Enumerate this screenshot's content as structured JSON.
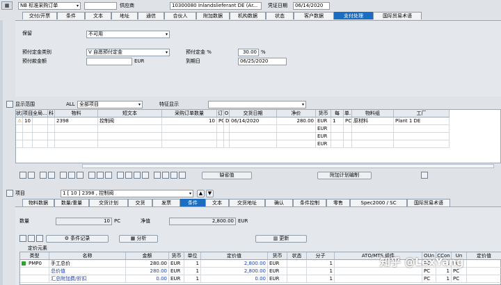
{
  "header": {
    "order_type": "NB 标准采购订单",
    "vendor_label": "供应商",
    "vendor_value": "10300080 Inlandslieferant DE (Ar...",
    "doc_date_label": "凭证日期",
    "doc_date_value": "06/14/2020"
  },
  "header_tabs": [
    "交付/开票",
    "条件",
    "文本",
    "地址",
    "通信",
    "合伙人",
    "附加数据",
    "机构数据",
    "状态",
    "客户数据",
    "支付处理",
    "国际贸易术语"
  ],
  "header_tabs_active": 10,
  "payment": {
    "retention_label": "保留",
    "retention_value": "不可用",
    "dp_category_label": "预付定金类别",
    "dp_category_value": "V  自愿预付定金",
    "dp_pct_label": "预付定金 %",
    "dp_pct_value": "30.00",
    "dp_pct_unit": "%",
    "dp_amount_label": "预付款金额",
    "dp_amount_value": "",
    "dp_amount_currency": "EUR",
    "due_date_label": "到期日",
    "due_date_value": "06/25/2020"
  },
  "items_overview": {
    "display_label": "显示范围",
    "display_code": "ALL",
    "display_value": "全部项目",
    "feature_label": "特征显示",
    "columns": [
      "状态",
      "项目",
      "全局...",
      "科",
      "物料",
      "短文本",
      "采购订单数量",
      "订",
      "O",
      "交货日期",
      "净价",
      "货币",
      "每",
      "单.",
      "物料组",
      "工厂"
    ],
    "rows": [
      {
        "item": "10",
        "material": "2398",
        "short_text": "控制阀",
        "qty": "10",
        "unit": "PC",
        "o": "D",
        "date": "06/14/2020",
        "price": "280.00",
        "currency": "EUR",
        "per": "1",
        "unit2": "PC",
        "mat_group": "原材料",
        "plant": "Plant 1 DE"
      },
      {
        "item": "",
        "material": "",
        "short_text": "",
        "qty": "",
        "unit": "",
        "o": "",
        "date": "",
        "price": "",
        "currency": "EUR",
        "per": "",
        "unit2": "",
        "mat_group": "",
        "plant": ""
      },
      {
        "item": "",
        "material": "",
        "short_text": "",
        "qty": "",
        "unit": "",
        "o": "",
        "date": "",
        "price": "",
        "currency": "EUR",
        "per": "",
        "unit2": "",
        "mat_group": "",
        "plant": ""
      },
      {
        "item": "",
        "material": "",
        "short_text": "",
        "qty": "",
        "unit": "",
        "o": "",
        "date": "",
        "price": "",
        "currency": "EUR",
        "per": "",
        "unit2": "",
        "mat_group": "",
        "plant": ""
      }
    ],
    "default_values_button": "缺省值",
    "additional_planning_button": "附加计划编制"
  },
  "item_detail": {
    "item_label": "项目",
    "item_value": "1 [ 10 ] 2398 , 控制阀",
    "tabs": [
      "物料数据",
      "数量/重量",
      "交货计划",
      "交货",
      "发票",
      "条件",
      "文本",
      "交货地址",
      "确认",
      "条件控制",
      "零售",
      "Spec2000 / SC",
      "国际贸易术语"
    ],
    "tabs_active": 5,
    "quantity_label": "数量",
    "quantity_value": "10",
    "quantity_unit": "PC",
    "net_label": "净值",
    "net_value": "2,800.00",
    "net_currency": "EUR",
    "condition_record_button": "条件记录",
    "analysis_button": "分析",
    "update_button": "更新",
    "pricing_elements_label": "定价元素",
    "cond_columns": [
      "类型",
      "名称",
      "金额",
      "货币",
      "单位",
      "定价值",
      "货币",
      "状态",
      "分子",
      "ATO/MTS 组件",
      "OUn",
      "CCon",
      "Un",
      "定价值"
    ],
    "cond_rows": [
      {
        "type": "PMP0",
        "name": "手工总价",
        "amount": "280.00",
        "cur": "EUR",
        "per": "1",
        "unit": "PC",
        "value": "2,800.00",
        "cur2": "EUR",
        "status": "",
        "num": "1",
        "oun": "PC",
        "ccon": "1",
        "un": "PC"
      },
      {
        "type": "",
        "name": "总价值",
        "amount": "280.00",
        "cur": "EUR",
        "per": "1",
        "unit": "PC",
        "value": "2,800.00",
        "cur2": "EUR",
        "status": "",
        "num": "1",
        "oun": "PC",
        "ccon": "1",
        "un": "PC"
      },
      {
        "type": "",
        "name": "汇总附加费/折扣",
        "amount": "0.00",
        "cur": "EUR",
        "per": "1",
        "unit": "PC",
        "value": "0.00",
        "cur2": "EUR",
        "status": "",
        "num": "1",
        "oun": "PC",
        "ccon": "1",
        "un": "PC"
      }
    ]
  },
  "watermark": "知乎 @LexYang"
}
